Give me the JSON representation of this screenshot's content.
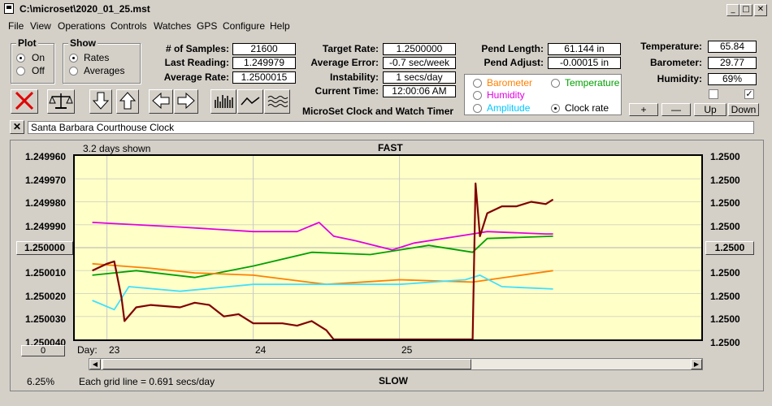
{
  "window": {
    "title": "C:\\microset\\2020_01_25.mst"
  },
  "menu": [
    "File",
    "View",
    "Operations",
    "Controls",
    "Watches",
    "GPS",
    "Configure",
    "Help"
  ],
  "plot_group": {
    "legend": "Plot",
    "options": [
      {
        "label": "On",
        "selected": true
      },
      {
        "label": "Off",
        "selected": false
      }
    ]
  },
  "show_group": {
    "legend": "Show",
    "options": [
      {
        "label": "Rates",
        "selected": true
      },
      {
        "label": "Averages",
        "selected": false
      }
    ]
  },
  "stats": {
    "samples_label": "# of Samples:",
    "samples": "21600",
    "last_label": "Last Reading:",
    "last": "1.249979",
    "avg_label": "Average Rate:",
    "avg": "1.2500015",
    "target_label": "Target Rate:",
    "target": "1.2500000",
    "avgerr_label": "Average Error:",
    "avgerr": "-0.7 sec/week",
    "instab_label": "Instability:",
    "instab": "1 secs/day",
    "time_label": "Current Time:",
    "time": "12:00:06 AM",
    "pendlen_label": "Pend Length:",
    "pendlen": "61.144 in",
    "pendadj_label": "Pend Adjust:",
    "pendadj": "-0.00015 in",
    "temp_label": "Temperature:",
    "temp": "65.84",
    "baro_label": "Barometer:",
    "baro": "29.77",
    "hum_label": "Humidity:",
    "hum": "69%"
  },
  "app_heading": "MicroSet Clock and Watch Timer",
  "series_selector": [
    {
      "label": "Barometer",
      "color": "#ff8000",
      "selected": false
    },
    {
      "label": "Temperature",
      "color": "#00a000",
      "selected": false
    },
    {
      "label": "Humidity",
      "color": "#e000e0",
      "selected": false
    },
    {
      "label": "Amplitude",
      "color": "#00c8ff",
      "selected": false
    },
    {
      "label": "Clock rate",
      "color": "#000000",
      "selected": true
    }
  ],
  "adjust_buttons": {
    "plus": "+",
    "minus": "—",
    "up": "Up",
    "down": "Down"
  },
  "checks": [
    false,
    true
  ],
  "clock_name": "Santa Barbara Courthouse Clock",
  "chart": {
    "days_shown": "3.2 days shown",
    "top_label": "FAST",
    "bottom_label": "SLOW",
    "left_ticks": [
      "1.249960",
      "1.249970",
      "1.249980",
      "1.249990",
      "1.250000",
      "1.250010",
      "1.250020",
      "1.250030",
      "1.250040"
    ],
    "right_ticks": [
      "1.2500",
      "1.2500",
      "1.2500",
      "1.2500",
      "1.2500",
      "1.2500",
      "1.2500",
      "1.2500",
      "1.2500"
    ],
    "center_left": "1.250000",
    "center_right": "1.2500",
    "offset_btn": "0",
    "day_label": "Day:",
    "days": [
      "23",
      "24",
      "25"
    ],
    "grid_note": "Each grid line = 0.691 secs/day",
    "zoom": "6.25%"
  },
  "chart_data": {
    "type": "line",
    "x_label": "Day",
    "y_label": "Rate",
    "ylim": [
      1.25004,
      1.24996
    ],
    "series": [
      {
        "name": "Clock rate",
        "color": "#800000",
        "points": [
          [
            22.9,
            1.25001
          ],
          [
            23.0,
            1.250007
          ],
          [
            23.05,
            1.250006
          ],
          [
            23.1,
            1.250022
          ],
          [
            23.12,
            1.250032
          ],
          [
            23.2,
            1.250026
          ],
          [
            23.3,
            1.250025
          ],
          [
            23.5,
            1.250026
          ],
          [
            23.6,
            1.250024
          ],
          [
            23.7,
            1.250025
          ],
          [
            23.8,
            1.25003
          ],
          [
            23.9,
            1.250029
          ],
          [
            24.0,
            1.250033
          ],
          [
            24.2,
            1.250033
          ],
          [
            24.3,
            1.250034
          ],
          [
            24.4,
            1.250032
          ],
          [
            24.5,
            1.250036
          ],
          [
            24.55,
            1.25004
          ],
          [
            25.5,
            1.25004
          ],
          [
            25.52,
            1.249972
          ],
          [
            25.55,
            1.249995
          ],
          [
            25.6,
            1.249985
          ],
          [
            25.7,
            1.249982
          ],
          [
            25.8,
            1.249982
          ],
          [
            25.9,
            1.24998
          ],
          [
            26.0,
            1.249981
          ],
          [
            26.05,
            1.249979
          ]
        ]
      },
      {
        "name": "Humidity",
        "color": "#e000e0",
        "points": [
          [
            22.9,
            1.249989
          ],
          [
            23.5,
            1.249991
          ],
          [
            24.0,
            1.249993
          ],
          [
            24.3,
            1.249993
          ],
          [
            24.45,
            1.249989
          ],
          [
            24.55,
            1.249995
          ],
          [
            24.7,
            1.249997
          ],
          [
            24.95,
            1.250001
          ],
          [
            25.1,
            1.249998
          ],
          [
            25.5,
            1.249994
          ],
          [
            25.6,
            1.249993
          ],
          [
            26.0,
            1.249994
          ],
          [
            26.05,
            1.249994
          ]
        ]
      },
      {
        "name": "Temperature",
        "color": "#00a000",
        "points": [
          [
            22.9,
            1.250012
          ],
          [
            23.2,
            1.25001
          ],
          [
            23.6,
            1.250013
          ],
          [
            24.0,
            1.250008
          ],
          [
            24.4,
            1.250002
          ],
          [
            24.8,
            1.250003
          ],
          [
            25.2,
            1.249999
          ],
          [
            25.5,
            1.250002
          ],
          [
            25.6,
            1.249996
          ],
          [
            26.05,
            1.249995
          ]
        ]
      },
      {
        "name": "Barometer",
        "color": "#ff8000",
        "points": [
          [
            22.9,
            1.250007
          ],
          [
            23.3,
            1.250009
          ],
          [
            23.6,
            1.250011
          ],
          [
            24.0,
            1.250012
          ],
          [
            24.5,
            1.250016
          ],
          [
            25.0,
            1.250014
          ],
          [
            25.5,
            1.250015
          ],
          [
            26.05,
            1.25001
          ]
        ]
      },
      {
        "name": "Amplitude",
        "color": "#40e0ff",
        "points": [
          [
            22.9,
            1.250023
          ],
          [
            23.05,
            1.250027
          ],
          [
            23.15,
            1.250017
          ],
          [
            23.5,
            1.250019
          ],
          [
            24.0,
            1.250016
          ],
          [
            24.5,
            1.250016
          ],
          [
            25.0,
            1.250016
          ],
          [
            25.45,
            1.250014
          ],
          [
            25.55,
            1.250012
          ],
          [
            25.7,
            1.250017
          ],
          [
            26.05,
            1.250018
          ]
        ]
      }
    ]
  }
}
